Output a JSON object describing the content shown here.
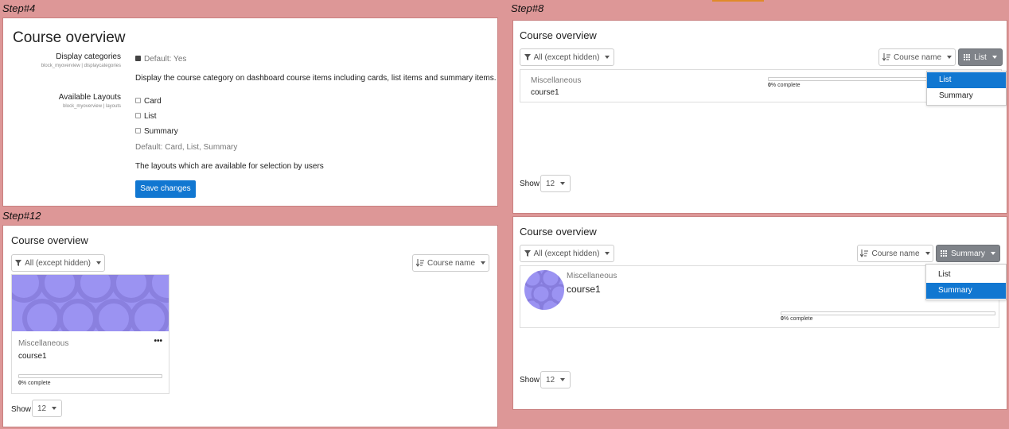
{
  "steps": {
    "step4": "Step#4",
    "step8": "Step#8",
    "step12": "Step#12"
  },
  "settings_panel": {
    "title": "Course overview",
    "display_categories": {
      "label": "Display categories",
      "key": "block_myoverview | displaycategories",
      "default": "Default: Yes",
      "checked": true,
      "description": "Display the course category on dashboard course items including cards, list items and summary items."
    },
    "available_layouts": {
      "label": "Available Layouts",
      "key": "block_myoverview | layouts",
      "options": [
        "Card",
        "List",
        "Summary"
      ],
      "default": "Default: Card, List, Summary",
      "description": "The layouts which are available for selection by users"
    },
    "save_label": "Save changes"
  },
  "block_common": {
    "title": "Course overview",
    "filter_label": "All (except hidden)",
    "sort_label": "Course name",
    "show_label": "Show",
    "per_page": "12",
    "category": "Miscellaneous",
    "course_name": "course1",
    "progress_value": "0",
    "progress_suffix": "% complete",
    "progress_fraction": 0
  },
  "step8": {
    "layout_label": "List",
    "menu_items": [
      "List",
      "Summary"
    ],
    "active_item": "List"
  },
  "step8b": {
    "layout_label": "Summary",
    "menu_items": [
      "List",
      "Summary"
    ],
    "active_item": "Summary"
  },
  "step12": {
    "card_menu": "•••"
  },
  "colors": {
    "background": "#dd9797",
    "primary": "#1177d1",
    "dark_button": "#7f8389",
    "course_image": "#9b93f2"
  }
}
